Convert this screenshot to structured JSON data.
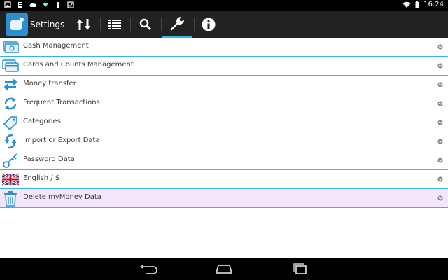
{
  "status_bar": {
    "time": "16:24",
    "left_icons": [
      "image-icon",
      "document-icon",
      "cloud-icon",
      "download-icon",
      "sd-card-icon",
      "check-box-icon"
    ],
    "right_icons": [
      "wifi-icon",
      "battery-icon"
    ]
  },
  "action_bar": {
    "title": "Settings",
    "tabs": [
      {
        "icon": "sort-arrows-icon",
        "active": false
      },
      {
        "icon": "list-icon",
        "active": false
      },
      {
        "icon": "search-icon",
        "active": false
      },
      {
        "icon": "wrench-icon",
        "active": true
      },
      {
        "icon": "info-icon",
        "active": false
      }
    ]
  },
  "settings": {
    "items": [
      {
        "label": "Cash Management",
        "icon": "cash-icon",
        "highlighted": false
      },
      {
        "label": "Cards and Counts Management",
        "icon": "card-icon",
        "highlighted": false
      },
      {
        "label": "Money transfer",
        "icon": "transfer-arrows-icon",
        "highlighted": false
      },
      {
        "label": "Frequent Transactions",
        "icon": "refresh-icon",
        "highlighted": false
      },
      {
        "label": "Categories",
        "icon": "tag-icon",
        "highlighted": false
      },
      {
        "label": "Import or Export Data",
        "icon": "sync-icon",
        "highlighted": false
      },
      {
        "label": "Password Data",
        "icon": "key-icon",
        "highlighted": false
      },
      {
        "label": "English / $",
        "icon": "uk-flag-icon",
        "highlighted": false
      },
      {
        "label": "Delete myMoney Data",
        "icon": "trash-icon",
        "highlighted": true
      }
    ]
  },
  "nav_bar": {
    "buttons": [
      "back-icon",
      "home-icon",
      "recent-apps-icon"
    ]
  },
  "colors": {
    "accent": "#33b5e5",
    "action_bar": "#222222",
    "highlight_row": "#f3e6fb",
    "icon_blue": "#2a8fd3"
  }
}
